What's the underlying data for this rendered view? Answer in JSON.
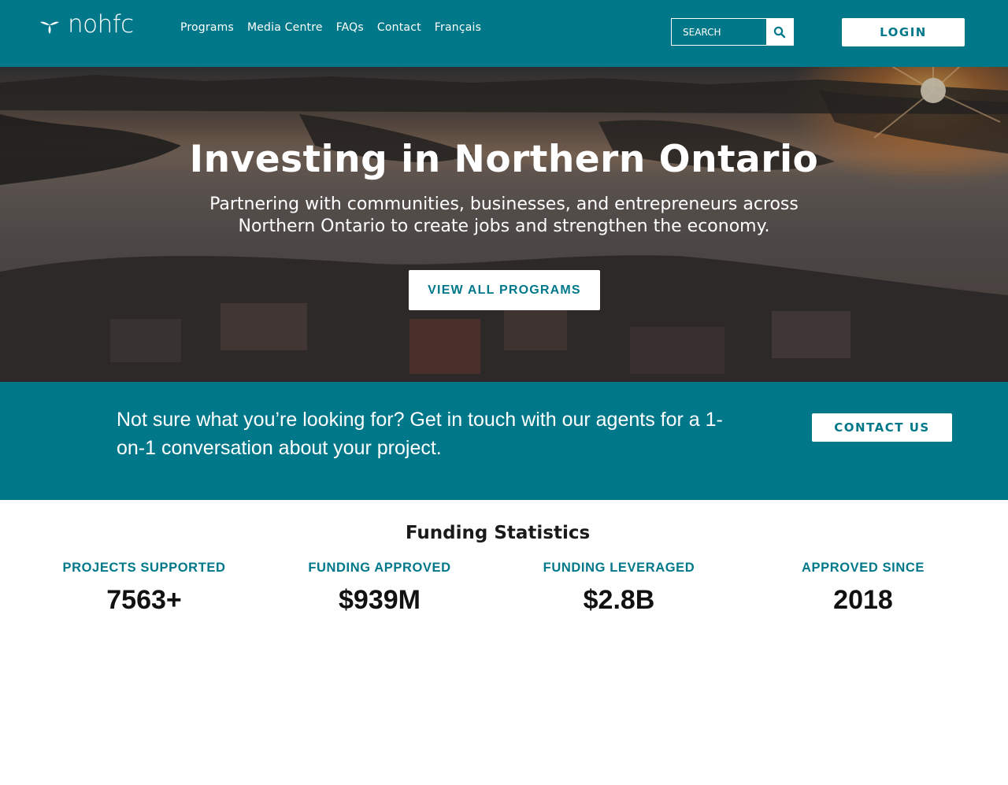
{
  "header": {
    "logo_text": "nohfc",
    "nav": [
      "Programs",
      "Media Centre",
      "FAQs",
      "Contact",
      "Français"
    ],
    "search_placeholder": "SEARCH",
    "search_icon": "search-icon",
    "login_label": "LOGIN"
  },
  "hero": {
    "title": "Investing in Northern Ontario",
    "subtitle": "Partnering with communities, businesses, and entrepreneurs across Northern Ontario to create jobs and strengthen the economy.",
    "button_label": "VIEW ALL PROGRAMS"
  },
  "cta": {
    "text": "Not sure what you’re looking for? Get in touch with our agents for a 1-on-1 conversation about your project.",
    "button_label": "CONTACT US"
  },
  "stats": {
    "title": "Funding Statistics",
    "items": [
      {
        "label": "PROJECTS SUPPORTED",
        "value": "7563+"
      },
      {
        "label": "FUNDING APPROVED",
        "value": "$939M"
      },
      {
        "label": "FUNDING LEVERAGED",
        "value": "$2.8B"
      },
      {
        "label": "APPROVED SINCE",
        "value": "2018"
      }
    ]
  },
  "colors": {
    "brand": "#00788a",
    "white": "#ffffff",
    "text": "#111111"
  }
}
